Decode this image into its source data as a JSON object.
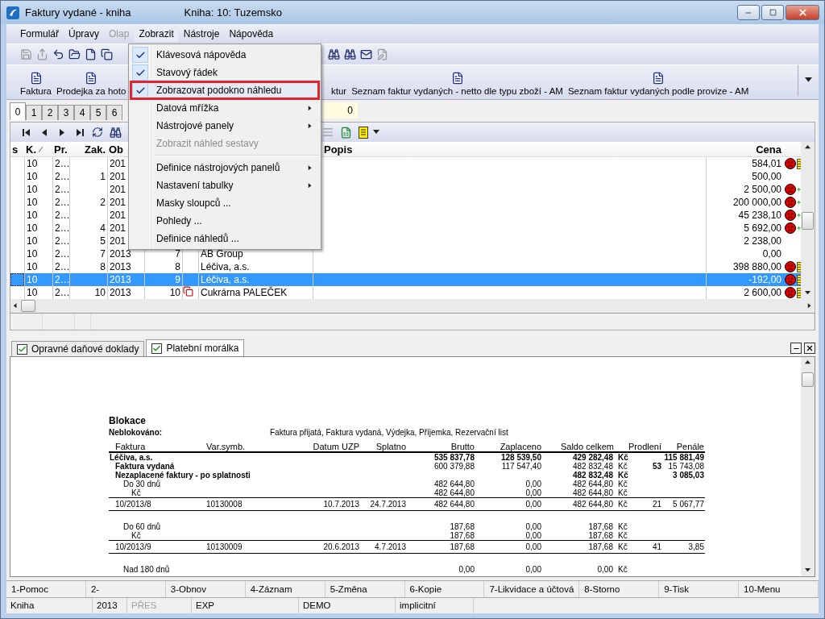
{
  "window": {
    "title": "Faktury vydané - kniha",
    "subtitle": "Kniha: 10: Tuzemsko"
  },
  "menu_bar": [
    {
      "label": "Formulář",
      "disabled": false,
      "open": false
    },
    {
      "label": "Úpravy",
      "disabled": false,
      "open": false
    },
    {
      "label": "Olap",
      "disabled": true,
      "open": false
    },
    {
      "label": "Zobrazit",
      "disabled": false,
      "open": true
    },
    {
      "label": "Nástroje",
      "disabled": false,
      "open": false
    },
    {
      "label": "Nápověda",
      "disabled": false,
      "open": false
    }
  ],
  "dropdown": [
    {
      "kind": "item",
      "label": "Klávesová nápověda",
      "checked": true,
      "submenu": false,
      "disabled": false,
      "highlighted": false
    },
    {
      "kind": "item",
      "label": "Stavový řádek",
      "checked": true,
      "submenu": false,
      "disabled": false,
      "highlighted": false
    },
    {
      "kind": "item",
      "label": "Zobrazovat podokno náhledu",
      "checked": true,
      "submenu": false,
      "disabled": false,
      "highlighted": true
    },
    {
      "kind": "item",
      "label": "Datová mřížka",
      "checked": false,
      "submenu": true,
      "disabled": false,
      "highlighted": false
    },
    {
      "kind": "item",
      "label": "Nástrojové panely",
      "checked": false,
      "submenu": true,
      "disabled": false,
      "highlighted": false
    },
    {
      "kind": "item",
      "label": "Zobrazit náhled sestavy",
      "checked": false,
      "submenu": false,
      "disabled": true,
      "highlighted": false
    },
    {
      "kind": "separator"
    },
    {
      "kind": "item",
      "label": "Definice nástrojových panelů",
      "checked": false,
      "submenu": true,
      "disabled": false,
      "highlighted": false
    },
    {
      "kind": "item",
      "label": "Nastavení tabulky",
      "checked": false,
      "submenu": true,
      "disabled": false,
      "highlighted": false
    },
    {
      "kind": "item",
      "label": "Masky sloupců ...",
      "checked": false,
      "submenu": false,
      "disabled": false,
      "highlighted": false
    },
    {
      "kind": "item",
      "label": "Pohledy ...",
      "checked": false,
      "submenu": false,
      "disabled": false,
      "highlighted": false
    },
    {
      "kind": "item",
      "label": "Definice náhledů ...",
      "checked": false,
      "submenu": false,
      "disabled": false,
      "highlighted": false
    }
  ],
  "toolbar": {
    "left": [
      {
        "disabled": true
      },
      {
        "disabled": true
      },
      {
        "disabled": false
      },
      {
        "disabled": false
      },
      {
        "disabled": false
      },
      {
        "disabled": false
      }
    ],
    "right": [
      {
        "disabled": false
      },
      {
        "disabled": false
      },
      {
        "disabled": false
      },
      {
        "disabled": true
      }
    ]
  },
  "report_toolbar": [
    {
      "label": "Faktura",
      "icon_hidden": false
    },
    {
      "label": "Prodejka za hoto",
      "icon_hidden": false
    },
    {
      "label": "ktur",
      "icon_hidden": true
    },
    {
      "label": "Seznam faktur vydaných - netto dle typu zboží - AM",
      "icon_hidden": false
    },
    {
      "label": "Seznam faktur vydaných podle provize - AM",
      "icon_hidden": false
    }
  ],
  "tabs": [
    {
      "label": "0",
      "selected": true
    },
    {
      "label": "1",
      "selected": false
    },
    {
      "label": "2",
      "selected": false
    },
    {
      "label": "3",
      "selected": false
    },
    {
      "label": "4",
      "selected": false
    },
    {
      "label": "5",
      "selected": false
    },
    {
      "label": "6",
      "selected": false
    }
  ],
  "counter": "0",
  "table": {
    "columns": [
      "s",
      "K.",
      "Pr.",
      "Zak.",
      "Ob",
      "Popis",
      "Cena"
    ],
    "rows": [
      {
        "k": "10",
        "pr": "2…",
        "ob": "201",
        "cena": "584,01",
        "overdue": true,
        "kind": "coins",
        "selected": false
      },
      {
        "k": "10",
        "pr": "2…",
        "zak": "1",
        "ob": "201",
        "cena": "500,00",
        "overdue": false,
        "kind": "plain",
        "selected": false
      },
      {
        "k": "10",
        "pr": "2…",
        "ob": "201",
        "cena": "2 500,00",
        "overdue": true,
        "kind": "bolt",
        "selected": false
      },
      {
        "k": "10",
        "pr": "2…",
        "zak": "2",
        "ob": "201",
        "cena": "200 000,00",
        "overdue": true,
        "kind": "bolt",
        "selected": false
      },
      {
        "k": "10",
        "pr": "2…",
        "ob": "201",
        "cena": "45 238,10",
        "overdue": true,
        "kind": "bolt",
        "selected": false
      },
      {
        "k": "10",
        "pr": "2…",
        "zak": "4",
        "ob": "201",
        "cena": "5 692,00",
        "overdue": true,
        "kind": "bolt",
        "selected": false
      },
      {
        "k": "10",
        "pr": "2…",
        "zak": "5",
        "ob": "201",
        "cena": "2 238,00",
        "overdue": false,
        "kind": "plain",
        "selected": false
      },
      {
        "k": "10",
        "pr": "2…",
        "zak": "7",
        "ob": "2013",
        "doc": "7",
        "name": "AB Group",
        "cena": "0,00",
        "overdue": false,
        "kind": "plain",
        "attachment": false,
        "selected": false
      },
      {
        "k": "10",
        "pr": "2…",
        "zak": "8",
        "ob": "2013",
        "doc": "8",
        "name": "Léčiva, a.s.",
        "cena": "398 880,00",
        "overdue": true,
        "kind": "coins",
        "attachment": false,
        "selected": false
      },
      {
        "k": "10",
        "pr": "2…",
        "ob": "2013",
        "doc": "9",
        "name": "Léčiva, a.s.",
        "cena": "-192,00",
        "overdue": true,
        "kind": "coins",
        "attachment": false,
        "selected": true
      },
      {
        "k": "10",
        "pr": "2…",
        "zak": "10",
        "ob": "2013",
        "doc": "10",
        "name": "Cukrárna PALEČEK",
        "cena": "2 600,00",
        "overdue": true,
        "kind": "coins",
        "attachment": true,
        "selected": false
      }
    ]
  },
  "preview_tabs": [
    {
      "label": "Opravné daňové doklady",
      "checked": true,
      "selected": false
    },
    {
      "label": "Platební morálka",
      "checked": true,
      "selected": true
    }
  ],
  "report": {
    "title": "Blokace",
    "note_label": "Neblokováno:",
    "note_text": "Faktura přijatá, Faktura vydaná, Výdejka, Příjemka, Rezervační list",
    "columns": [
      "Faktura",
      "Var.symb.",
      "Datum UZP",
      "Splatno",
      "Brutto",
      "Zaplaceno",
      "Saldo celkem",
      "Prodlení",
      "Penále"
    ],
    "rows": [
      {
        "kind": "customer",
        "label": "Léčiva, a.s.",
        "gross": "535 837,78",
        "paid": "128 539,50",
        "balance": "429 282,48",
        "currency": "Kč",
        "penalty": "115 881,49"
      },
      {
        "kind": "doctype",
        "label": "Faktura vydaná",
        "gross": "600 379,88",
        "paid": "117 547,40",
        "balance": "482 832,48",
        "currency": "Kč",
        "delay": "53",
        "penalty": "15 743,08"
      },
      {
        "kind": "overdue",
        "label": "Nezaplacené faktury - po splatnosti",
        "balance": "482 832,48",
        "currency": "Kč",
        "penalty": "3 085,03"
      },
      {
        "kind": "bucket",
        "label": "Do 30 dnů",
        "gross": "482 644,80",
        "paid": "0,00",
        "balance": "482 644,80",
        "currency": "Kč"
      },
      {
        "kind": "currency",
        "label": "Kč",
        "gross": "482 644,80",
        "paid": "0,00",
        "balance": "482 644,80",
        "currency": "Kč"
      },
      {
        "kind": "invoice",
        "label": "10/2013/8",
        "var_symbol": "10130008",
        "date_uzp": "10.7.2013",
        "due": "24.7.2013",
        "gross": "482 644,80",
        "paid": "0,00",
        "balance": "482 644,80",
        "currency": "Kč",
        "delay": "21",
        "penalty": "5 067,77"
      },
      {
        "kind": "bucket",
        "label": "Do 60 dnů",
        "gross": "187,68",
        "paid": "0,00",
        "balance": "187,68",
        "currency": "Kč"
      },
      {
        "kind": "currency",
        "label": "Kč",
        "gross": "187,68",
        "paid": "0,00",
        "balance": "187,68",
        "currency": "Kč"
      },
      {
        "kind": "invoice",
        "label": "10/2013/9",
        "var_symbol": "10130009",
        "date_uzp": "20.6.2013",
        "due": "4.7.2013",
        "gross": "187,68",
        "paid": "0,00",
        "balance": "187,68",
        "currency": "Kč",
        "delay": "41",
        "penalty": "3,85"
      },
      {
        "kind": "bucket",
        "label": "Nad 180 dnů",
        "gross": "0,00",
        "paid": "0,00",
        "balance": "0,00",
        "currency": "Kč"
      }
    ]
  },
  "function_keys": [
    "1-Pomoc",
    "2-",
    "3-Obnov",
    "4-Záznam",
    "5-Změna",
    "6-Kopie",
    "7-Likvidace a účtová",
    "8-Storno",
    "9-Tisk",
    "10-Menu"
  ],
  "status_bar": [
    {
      "text": "Kniha",
      "disabled": false
    },
    {
      "text": "2013",
      "disabled": false
    },
    {
      "text": "PŘES",
      "disabled": true
    },
    {
      "text": "EXP",
      "disabled": false
    },
    {
      "text": "DEMO",
      "disabled": false
    },
    {
      "text": "implicitní",
      "disabled": false
    }
  ]
}
